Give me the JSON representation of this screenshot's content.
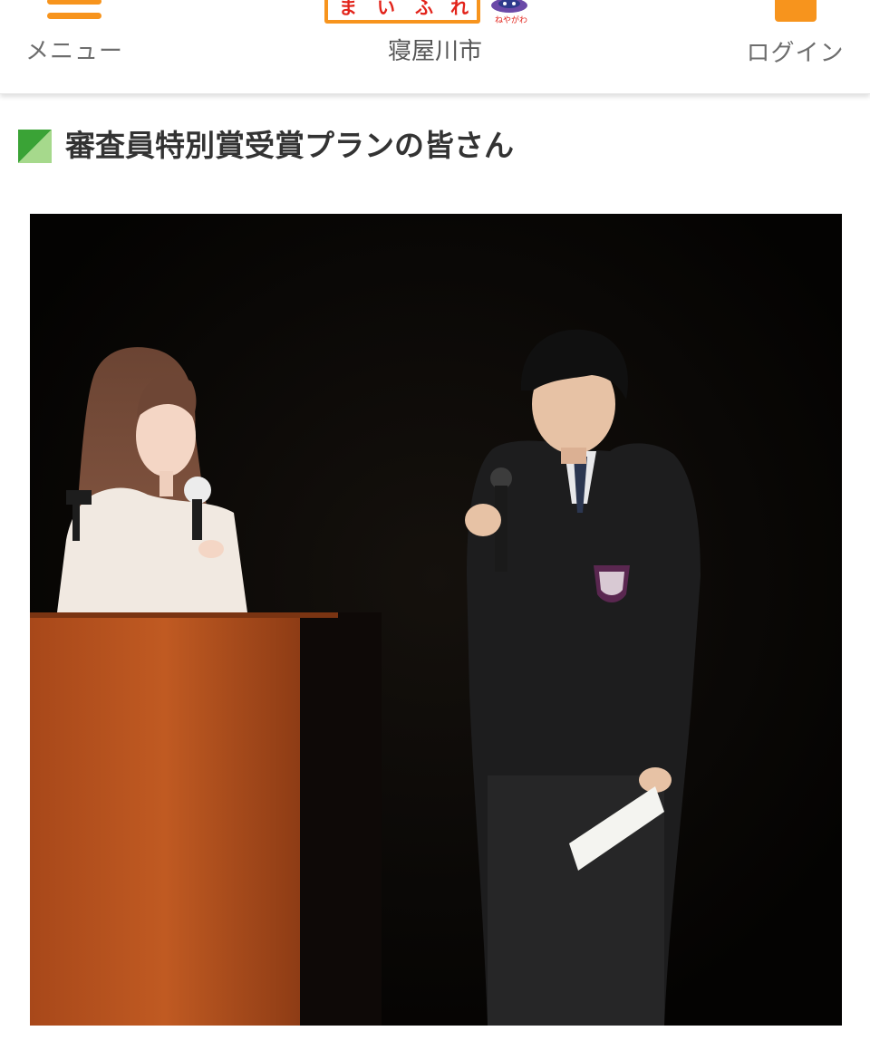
{
  "header": {
    "menu_label": "メニュー",
    "logo_text": [
      "ま",
      "い",
      "ふ",
      "れ"
    ],
    "logo_mascot_caption": "ねやがわ",
    "city_name": "寝屋川市",
    "login_label": "ログイン"
  },
  "section": {
    "heading": "審査員特別賞受賞プランの皆さん"
  },
  "colors": {
    "accent_orange": "#f7941d",
    "heading_marker_dark": "#3aa336",
    "heading_marker_light": "#a6d98c",
    "logo_red": "#e2231a"
  },
  "icons": {
    "menu": "hamburger-icon",
    "login": "user-icon",
    "heading": "green-triangle-marker-icon",
    "logo": "mascot-icon"
  }
}
